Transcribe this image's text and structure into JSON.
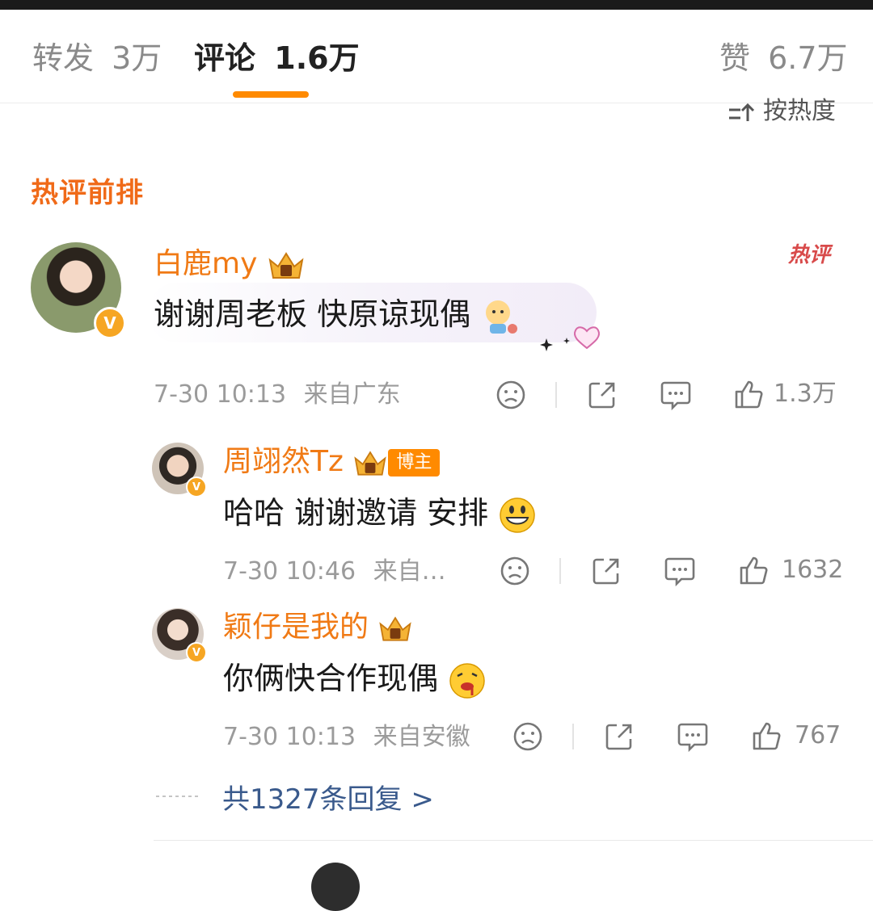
{
  "tabs": {
    "repost_label": "转发",
    "repost_count": "3万",
    "comment_label": "评论",
    "comment_count": "1.6万",
    "like_label": "赞",
    "like_count": "6.7万"
  },
  "sort_label": "按热度",
  "section_title": "热评前排",
  "hot_badge": "热评",
  "comments": [
    {
      "username": "白鹿my",
      "text": "谢谢周老板 快原谅现偶",
      "time": "7-30 10:13",
      "location": "来自广东",
      "likes": "1.3万"
    }
  ],
  "replies": [
    {
      "username": "周翊然Tz",
      "tag": "博主",
      "text": "哈哈 谢谢邀请 安排",
      "time": "7-30 10:46",
      "location": "来自…",
      "likes": "1632"
    },
    {
      "username": "颖仔是我的",
      "text": "你俩快合作现偶",
      "time": "7-30 10:13",
      "location": "来自安徽",
      "likes": "767"
    }
  ],
  "more_replies": "共1327条回复 >",
  "colors": {
    "accent": "#ff8a00",
    "username": "#f07a15",
    "section": "#f06a18",
    "link": "#3a5a8c"
  },
  "icons": [
    "sad-face-icon",
    "share-icon",
    "comment-icon",
    "thumbs-up-icon",
    "crown-icon",
    "verified-badge-icon",
    "sort-icon"
  ]
}
